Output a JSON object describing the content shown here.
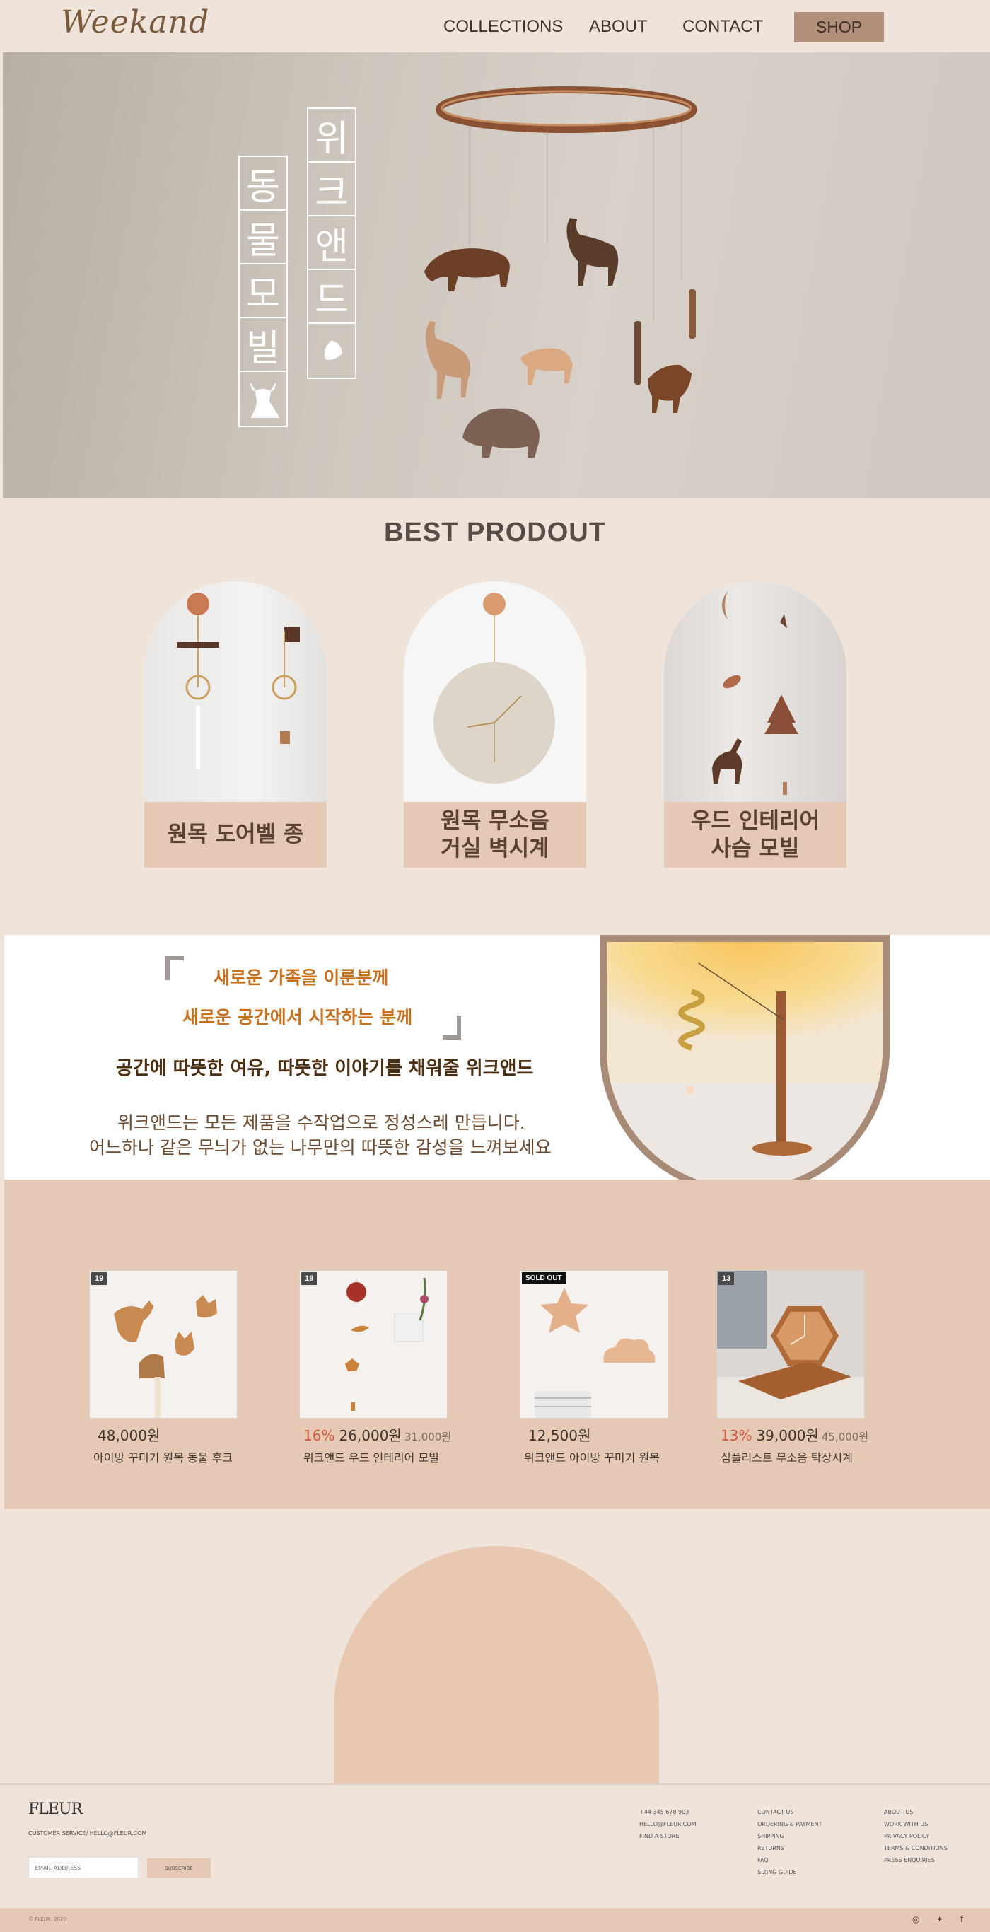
{
  "header": {
    "logo": "Weekand",
    "nav": {
      "collections": "COLLECTIONS",
      "about": "ABOUT",
      "contact": "CONTACT"
    },
    "shop_label": "SHOP"
  },
  "hero": {
    "title_right": [
      "위",
      "크",
      "앤",
      "드"
    ],
    "title_left": [
      "동",
      "물",
      "모",
      "빌"
    ]
  },
  "best": {
    "title": "BEST PRODOUT",
    "items": [
      {
        "label": "원목 도어벨 종"
      },
      {
        "label": "원목 무소음\n거실 벽시계"
      },
      {
        "label": "우드 인테리어\n사슴 모빌"
      }
    ]
  },
  "story": {
    "line1": "새로운 가족을 이룬분께",
    "line2": "새로운 공간에서 시작하는 분께",
    "line3": "공간에 따뜻한 여유, 따뜻한 이야기를 채워줄 위크앤드",
    "line4": "위크앤드는 모든 제품을 수작업으로 정성스레 만듭니다.",
    "line5": "어느하나 같은 무늬가 없는 나무만의 따뜻한 감성을 느껴보세요"
  },
  "products": [
    {
      "badge": "19",
      "discount": "",
      "price": "48,000원",
      "original": "",
      "name": "아이방 꾸미기 원목 동물 후크"
    },
    {
      "badge": "18",
      "discount": "16%",
      "price": "26,000원",
      "original": "31,000원",
      "name": "위크앤드 우드 인테리어 모빌"
    },
    {
      "badge": "SOLD OUT",
      "discount": "",
      "price": "12,500원",
      "original": "",
      "name": "위크앤드 아이방 꾸미기 원목"
    },
    {
      "badge": "13",
      "discount": "13%",
      "price": "39,000원",
      "original": "45,000원",
      "name": "심플리스트 무소음 탁상시계"
    }
  ],
  "footer": {
    "logo": "FLEUR",
    "email_line": "CUSTOMER SERVICE/ HELLO@FLEUR.COM",
    "input_placeholder": "EMAIL ADDRESS",
    "subscribe": "SUBSCRIBE",
    "col1": [
      "+44 345 678 903",
      "HELLO@FLEUR.COM",
      "FIND A STORE"
    ],
    "col2": [
      "CONTACT US",
      "ORDERING & PAYMENT",
      "SHIPPING",
      "RETURNS",
      "FAQ",
      "SIZING GUIDE"
    ],
    "col3": [
      "ABOUT US",
      "WORK WITH US",
      "PRIVACY POLICY",
      "TERMS & CONDITIONS",
      "PRESS ENQUIRIES"
    ],
    "copyright": "© FLEUR, 2020",
    "social": [
      "◎",
      "✦",
      "f"
    ]
  },
  "colors": {
    "page_bg": "#efe3da",
    "accent": "#e5c9b4",
    "shop_button": "#b0907a",
    "story_highlight": "#c86f1e",
    "discount": "#d0573c"
  }
}
